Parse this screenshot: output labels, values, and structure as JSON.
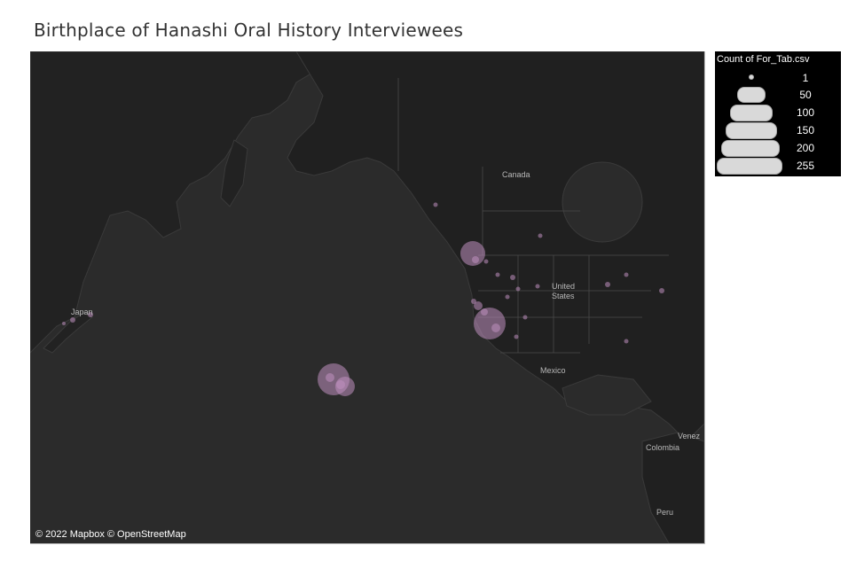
{
  "title": "Birthplace of Hanashi Oral History Interviewees",
  "map": {
    "country_labels": [
      {
        "id": "canada",
        "text": "Canada"
      },
      {
        "id": "united",
        "text": "United"
      },
      {
        "id": "states",
        "text": "States"
      },
      {
        "id": "mexico",
        "text": "Mexico"
      },
      {
        "id": "japan",
        "text": "Japan"
      },
      {
        "id": "colombia",
        "text": "Colombia"
      },
      {
        "id": "peru",
        "text": "Peru"
      },
      {
        "id": "venezuela",
        "text": "Venez"
      }
    ],
    "attribution": "© 2022 Mapbox © OpenStreetMap",
    "marker_color": "#c08fc0"
  },
  "legend": {
    "title": "Count of For_Tab.csv",
    "items": [
      {
        "label": "1",
        "value": 1
      },
      {
        "label": "50",
        "value": 50
      },
      {
        "label": "100",
        "value": 100
      },
      {
        "label": "150",
        "value": 150
      },
      {
        "label": "200",
        "value": 200
      },
      {
        "label": "255",
        "value": 255
      }
    ]
  }
}
